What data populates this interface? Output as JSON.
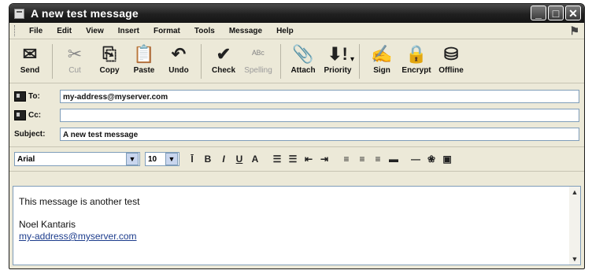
{
  "window": {
    "title": "A new test message",
    "buttons": [
      "_",
      "□",
      "✕"
    ]
  },
  "menu": [
    "File",
    "Edit",
    "View",
    "Insert",
    "Format",
    "Tools",
    "Message",
    "Help"
  ],
  "toolbar": [
    {
      "label": "Send",
      "icon": "send-icon",
      "glyph": "✉",
      "enabled": true
    },
    {
      "label": "Cut",
      "icon": "cut-icon",
      "glyph": "✂",
      "enabled": false
    },
    {
      "label": "Copy",
      "icon": "copy-icon",
      "glyph": "⎘",
      "enabled": true
    },
    {
      "label": "Paste",
      "icon": "paste-icon",
      "glyph": "📋",
      "enabled": true
    },
    {
      "label": "Undo",
      "icon": "undo-icon",
      "glyph": "↶",
      "enabled": true
    },
    {
      "label": "Check",
      "icon": "check-names-icon",
      "glyph": "✔",
      "enabled": true
    },
    {
      "label": "Spelling",
      "icon": "spelling-icon",
      "glyph": "ᴬᴮᶜ",
      "enabled": false
    },
    {
      "label": "Attach",
      "icon": "paperclip-icon",
      "glyph": "📎",
      "enabled": true
    },
    {
      "label": "Priority",
      "icon": "priority-icon",
      "glyph": "⬇!",
      "enabled": true
    },
    {
      "label": "Sign",
      "icon": "sign-icon",
      "glyph": "✍",
      "enabled": true
    },
    {
      "label": "Encrypt",
      "icon": "encrypt-icon",
      "glyph": "🔒",
      "enabled": true
    },
    {
      "label": "Offline",
      "icon": "offline-icon",
      "glyph": "⛁",
      "enabled": true
    }
  ],
  "header": {
    "to_label": "To:",
    "to_value": "my-address@myserver.com",
    "cc_label": "Cc:",
    "cc_value": "",
    "subject_label": "Subject:",
    "subject_value": "A new test message"
  },
  "format": {
    "font": "Arial",
    "size": "10"
  },
  "body": {
    "line1": "This message is another test",
    "signature_name": "Noel Kantaris",
    "signature_email": "my-address@myserver.com"
  }
}
